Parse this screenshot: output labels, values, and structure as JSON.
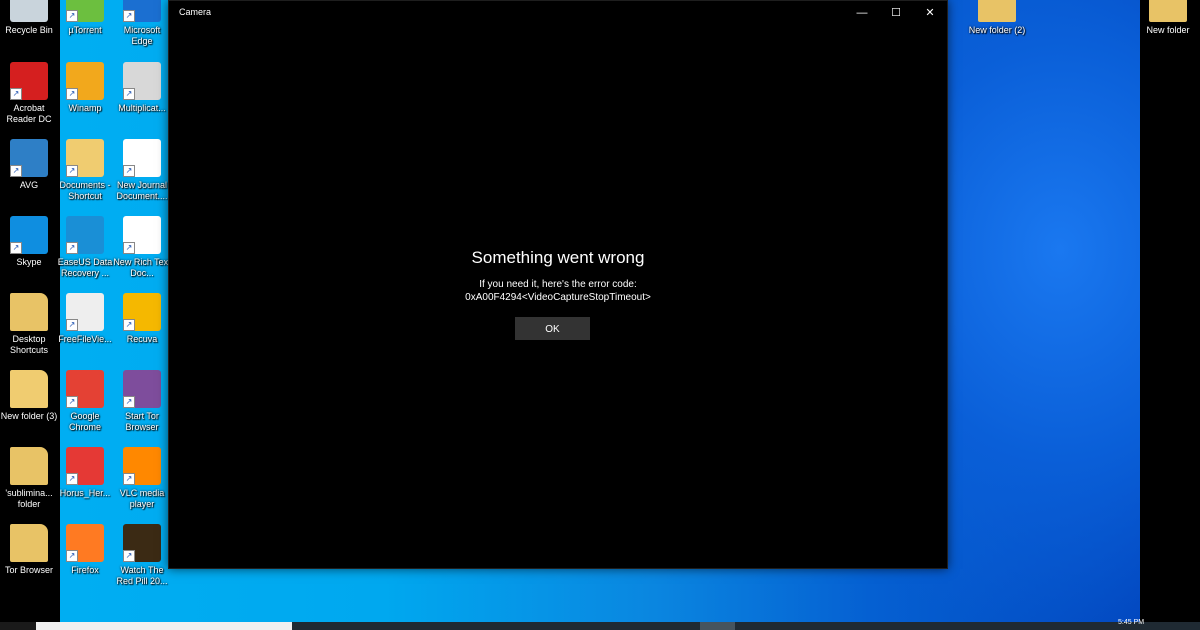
{
  "desktop": {
    "icons": [
      {
        "label": "Recycle Bin",
        "icon": "recycle-bin-icon",
        "color": "#c9d4dc"
      },
      {
        "label": "Acrobat Reader DC",
        "icon": "acrobat-icon",
        "color": "#d51f1f"
      },
      {
        "label": "AVG",
        "icon": "avg-icon",
        "color": "#2e7fc6"
      },
      {
        "label": "Skype",
        "icon": "skype-icon",
        "color": "#0f8ee0"
      },
      {
        "label": "Desktop Shortcuts",
        "icon": "folder-icon",
        "color": "#e8c366"
      },
      {
        "label": "New folder (3)",
        "icon": "folder-icon",
        "color": "#f0cc70"
      },
      {
        "label": "'sublimina... folder",
        "icon": "folder-icon",
        "color": "#e8c366"
      },
      {
        "label": "Tor Browser",
        "icon": "folder-icon",
        "color": "#e8c366"
      },
      {
        "label": "µTorrent",
        "icon": "utorrent-icon",
        "color": "#6cbf3f"
      },
      {
        "label": "Winamp",
        "icon": "winamp-icon",
        "color": "#f2a81c"
      },
      {
        "label": "Documents - Shortcut",
        "icon": "documents-folder-icon",
        "color": "#f0cc70"
      },
      {
        "label": "EaseUS Data Recovery ...",
        "icon": "easeus-icon",
        "color": "#1a8fd6"
      },
      {
        "label": "FreeFileVie...",
        "icon": "freefileviewer-icon",
        "color": "#eeeeee"
      },
      {
        "label": "Google Chrome",
        "icon": "chrome-icon",
        "color": "#e44134"
      },
      {
        "label": "Horus_Her...",
        "icon": "pdf-file-icon",
        "color": "#e53935"
      },
      {
        "label": "Firefox",
        "icon": "firefox-icon",
        "color": "#ff7a22"
      },
      {
        "label": "Microsoft Edge",
        "icon": "edge-icon",
        "color": "#1b6fd1"
      },
      {
        "label": "Multiplicat...",
        "icon": "multiplication-icon",
        "color": "#d8d8d8"
      },
      {
        "label": "New Journal Document....",
        "icon": "journal-document-icon",
        "color": "#ffffff"
      },
      {
        "label": "New Rich Text Doc...",
        "icon": "rich-text-document-icon",
        "color": "#ffffff"
      },
      {
        "label": "Recuva",
        "icon": "recuva-icon",
        "color": "#f5b800"
      },
      {
        "label": "Start Tor Browser",
        "icon": "tor-browser-icon",
        "color": "#7e4d9c"
      },
      {
        "label": "VLC media player",
        "icon": "vlc-icon",
        "color": "#ff8800"
      },
      {
        "label": "Watch The Red Pill 20...",
        "icon": "video-file-icon",
        "color": "#3b2a14"
      },
      {
        "label": "New folder (2)",
        "icon": "folder-icon",
        "color": "#e8c366"
      },
      {
        "label": "New folder",
        "icon": "folder-icon",
        "color": "#e8c366"
      }
    ]
  },
  "window": {
    "title": "Camera",
    "minimize": "—",
    "maximize": "☐",
    "close": "✕",
    "error": {
      "title": "Something went wrong",
      "line1": "If you need it, here's the error code:",
      "line2": "0xA00F4294<VideoCaptureStopTimeout>",
      "ok_label": "OK"
    }
  },
  "taskbar": {
    "clock": "5:45 PM"
  }
}
